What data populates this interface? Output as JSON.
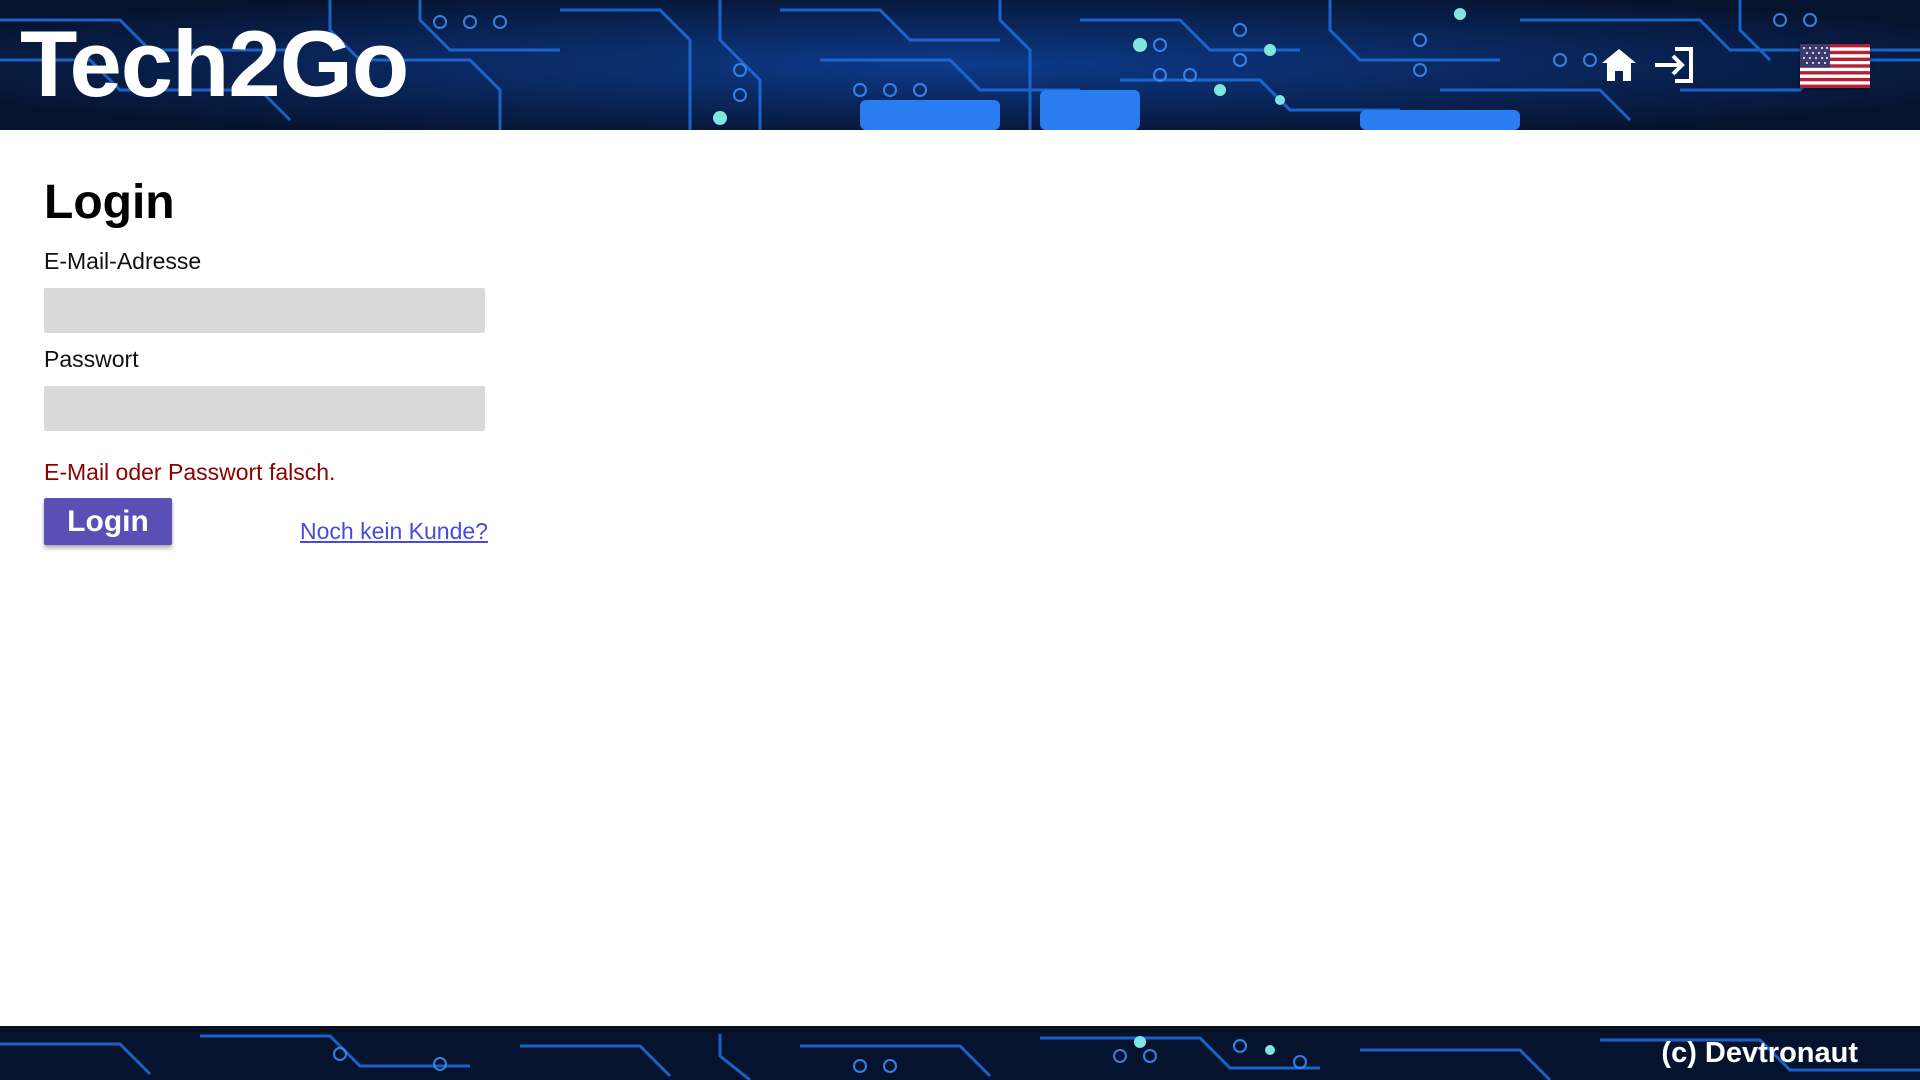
{
  "header": {
    "brand": "Tech2Go",
    "language_flag": "us-flag-icon",
    "icons": [
      "home-icon",
      "login-icon"
    ]
  },
  "main": {
    "title": "Login",
    "email_label": "E-Mail-Adresse",
    "email_value": "",
    "password_label": "Passwort",
    "password_value": "",
    "error_message": "E-Mail oder Passwort falsch.",
    "login_button": "Login",
    "register_link": "Noch kein Kunde?"
  },
  "footer": {
    "copyright": "(c) Devtronaut"
  },
  "colors": {
    "header_background": "#07183a",
    "circuit_trace": "#1f6fe0",
    "button": "#5a4fb4",
    "error": "#8b0000",
    "link": "#4a4ae0",
    "input_background": "#d9d9d9"
  }
}
